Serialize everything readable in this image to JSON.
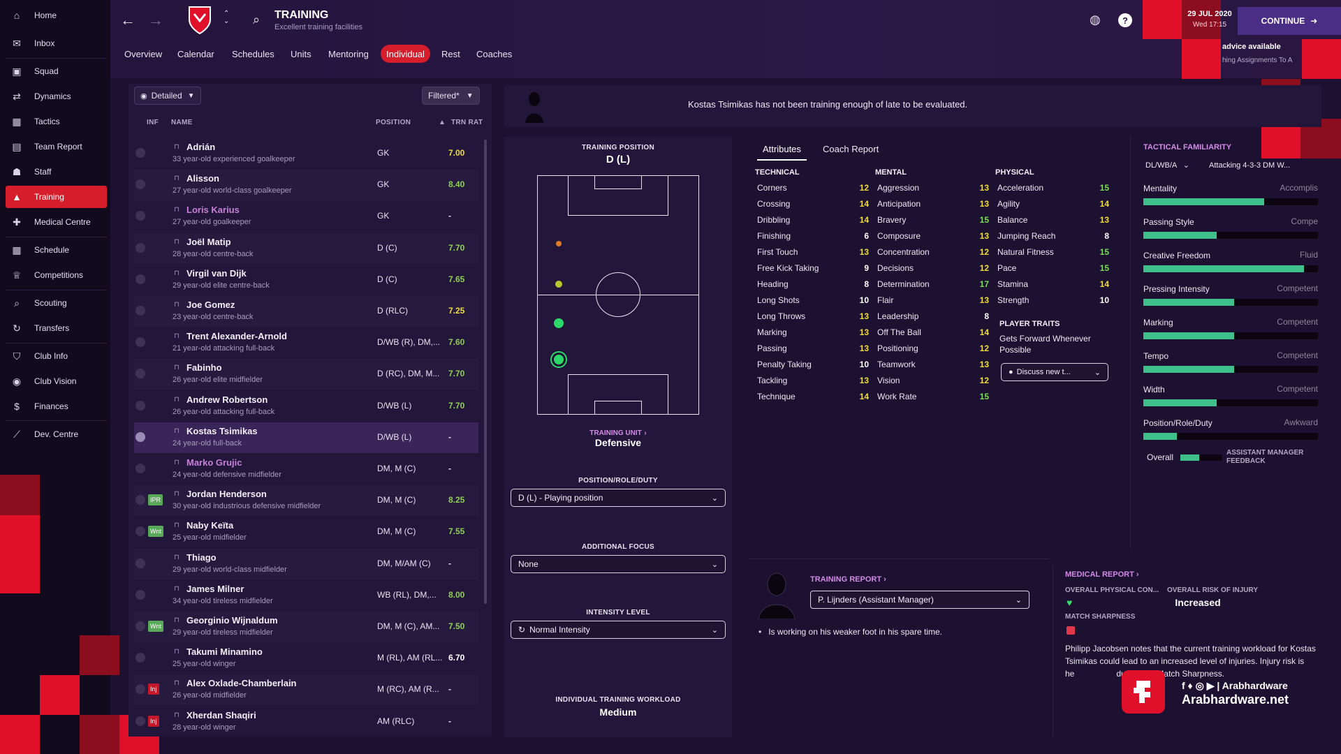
{
  "sidebar": {
    "items": [
      {
        "label": "Home",
        "icon": "home-icon"
      },
      {
        "label": "Inbox",
        "icon": "inbox-icon"
      },
      {
        "label": "Squad",
        "icon": "squad-icon"
      },
      {
        "label": "Dynamics",
        "icon": "dynamics-icon"
      },
      {
        "label": "Tactics",
        "icon": "tactics-icon"
      },
      {
        "label": "Team Report",
        "icon": "report-icon"
      },
      {
        "label": "Staff",
        "icon": "staff-icon"
      },
      {
        "label": "Training",
        "icon": "training-icon"
      },
      {
        "label": "Medical Centre",
        "icon": "medical-icon"
      },
      {
        "label": "Schedule",
        "icon": "schedule-icon"
      },
      {
        "label": "Competitions",
        "icon": "trophy-icon"
      },
      {
        "label": "Scouting",
        "icon": "scouting-icon"
      },
      {
        "label": "Transfers",
        "icon": "transfers-icon"
      },
      {
        "label": "Club Info",
        "icon": "club-info-icon"
      },
      {
        "label": "Club Vision",
        "icon": "club-vision-icon"
      },
      {
        "label": "Finances",
        "icon": "finances-icon"
      },
      {
        "label": "Dev. Centre",
        "icon": "dev-centre-icon"
      }
    ]
  },
  "header": {
    "title": "TRAINING",
    "subtitle": "Excellent training facilities",
    "date": "29 JUL 2020",
    "time": "Wed 17:15",
    "continue_label": "CONTINUE",
    "advice_title": "advice available",
    "advice_sub": "hing Assignments To A",
    "help_label": "?"
  },
  "tabs": [
    "Overview",
    "Calendar",
    "Schedules",
    "Units",
    "Mentoring",
    "Individual",
    "Rest",
    "Coaches"
  ],
  "list": {
    "view_label": "Detailed",
    "filter_label": "Filtered*",
    "col_inf": "INF",
    "col_name": "NAME",
    "col_position": "POSITION",
    "col_rating": "TRN RAT",
    "players": [
      {
        "name": "Adrián",
        "desc": "33 year-old experienced goalkeeper",
        "pos": "GK",
        "rating": "7.00",
        "inf": ""
      },
      {
        "name": "Alisson",
        "desc": "27 year-old world-class goalkeeper",
        "pos": "GK",
        "rating": "8.40",
        "inf": ""
      },
      {
        "name": "Loris Karius",
        "desc": "27 year-old goalkeeper",
        "pos": "GK",
        "rating": "-",
        "inf": ""
      },
      {
        "name": "Joël Matip",
        "desc": "28 year-old centre-back",
        "pos": "D (C)",
        "rating": "7.70",
        "inf": ""
      },
      {
        "name": "Virgil van Dijk",
        "desc": "29 year-old elite centre-back",
        "pos": "D (C)",
        "rating": "7.65",
        "inf": ""
      },
      {
        "name": "Joe Gomez",
        "desc": "23 year-old centre-back",
        "pos": "D (RLC)",
        "rating": "7.25",
        "inf": ""
      },
      {
        "name": "Trent Alexander-Arnold",
        "desc": "21 year-old attacking full-back",
        "pos": "D/WB (R), DM,...",
        "rating": "7.60",
        "inf": ""
      },
      {
        "name": "Fabinho",
        "desc": "26 year-old elite midfielder",
        "pos": "D (RC), DM, M...",
        "rating": "7.70",
        "inf": ""
      },
      {
        "name": "Andrew Robertson",
        "desc": "26 year-old attacking full-back",
        "pos": "D/WB (L)",
        "rating": "7.70",
        "inf": ""
      },
      {
        "name": "Kostas Tsimikas",
        "desc": "24 year-old full-back",
        "pos": "D/WB (L)",
        "rating": "-",
        "inf": ""
      },
      {
        "name": "Marko Grujic",
        "desc": "24 year-old defensive midfielder",
        "pos": "DM, M (C)",
        "rating": "-",
        "inf": ""
      },
      {
        "name": "Jordan Henderson",
        "desc": "30 year-old industrious defensive midfielder",
        "pos": "DM, M (C)",
        "rating": "8.25",
        "inf": "IPR"
      },
      {
        "name": "Naby Keïta",
        "desc": "25 year-old midfielder",
        "pos": "DM, M (C)",
        "rating": "7.55",
        "inf": "Wnt"
      },
      {
        "name": "Thiago",
        "desc": "29 year-old world-class midfielder",
        "pos": "DM, M/AM (C)",
        "rating": "-",
        "inf": ""
      },
      {
        "name": "James Milner",
        "desc": "34 year-old tireless midfielder",
        "pos": "WB (RL), DM,...",
        "rating": "8.00",
        "inf": ""
      },
      {
        "name": "Georginio Wijnaldum",
        "desc": "29 year-old tireless midfielder",
        "pos": "DM, M (C), AM...",
        "rating": "7.50",
        "inf": "Wnt"
      },
      {
        "name": "Takumi Minamino",
        "desc": "25 year-old winger",
        "pos": "M (RL), AM (RL...",
        "rating": "6.70",
        "inf": ""
      },
      {
        "name": "Alex Oxlade-Chamberlain",
        "desc": "26 year-old midfielder",
        "pos": "M (RC), AM (R...",
        "rating": "-",
        "inf": "Inj"
      },
      {
        "name": "Xherdan Shaqiri",
        "desc": "28 year-old winger",
        "pos": "AM (RLC)",
        "rating": "-",
        "inf": "Inj"
      }
    ]
  },
  "message": "Kostas Tsimikas has not been training enough of late to be evaluated.",
  "center": {
    "training_position_label": "TRAINING POSITION",
    "training_position": "D (L)",
    "training_unit_label": "TRAINING UNIT",
    "training_unit": "Defensive",
    "prd_label": "POSITION/ROLE/DUTY",
    "prd_value": "D (L) - Playing position",
    "focus_label": "ADDITIONAL FOCUS",
    "focus_value": "None",
    "intensity_label": "INTENSITY LEVEL",
    "intensity_value": "Normal Intensity",
    "workload_label": "INDIVIDUAL TRAINING WORKLOAD",
    "workload_value": "Medium"
  },
  "attributes": {
    "tabs": [
      "Attributes",
      "Coach Report"
    ],
    "technical_label": "TECHNICAL",
    "mental_label": "MENTAL",
    "physical_label": "PHYSICAL",
    "technical": [
      {
        "name": "Corners",
        "value": "12"
      },
      {
        "name": "Crossing",
        "value": "14"
      },
      {
        "name": "Dribbling",
        "value": "14"
      },
      {
        "name": "Finishing",
        "value": "6"
      },
      {
        "name": "First Touch",
        "value": "13"
      },
      {
        "name": "Free Kick Taking",
        "value": "9"
      },
      {
        "name": "Heading",
        "value": "8"
      },
      {
        "name": "Long Shots",
        "value": "10"
      },
      {
        "name": "Long Throws",
        "value": "13"
      },
      {
        "name": "Marking",
        "value": "13"
      },
      {
        "name": "Passing",
        "value": "13"
      },
      {
        "name": "Penalty Taking",
        "value": "10"
      },
      {
        "name": "Tackling",
        "value": "13"
      },
      {
        "name": "Technique",
        "value": "14"
      }
    ],
    "mental": [
      {
        "name": "Aggression",
        "value": "13"
      },
      {
        "name": "Anticipation",
        "value": "13"
      },
      {
        "name": "Bravery",
        "value": "15"
      },
      {
        "name": "Composure",
        "value": "13"
      },
      {
        "name": "Concentration",
        "value": "12"
      },
      {
        "name": "Decisions",
        "value": "12"
      },
      {
        "name": "Determination",
        "value": "17"
      },
      {
        "name": "Flair",
        "value": "13"
      },
      {
        "name": "Leadership",
        "value": "8"
      },
      {
        "name": "Off The Ball",
        "value": "14"
      },
      {
        "name": "Positioning",
        "value": "12"
      },
      {
        "name": "Teamwork",
        "value": "13"
      },
      {
        "name": "Vision",
        "value": "12"
      },
      {
        "name": "Work Rate",
        "value": "15"
      }
    ],
    "physical": [
      {
        "name": "Acceleration",
        "value": "15"
      },
      {
        "name": "Agility",
        "value": "14"
      },
      {
        "name": "Balance",
        "value": "13"
      },
      {
        "name": "Jumping Reach",
        "value": "8"
      },
      {
        "name": "Natural Fitness",
        "value": "15"
      },
      {
        "name": "Pace",
        "value": "15"
      },
      {
        "name": "Stamina",
        "value": "14"
      },
      {
        "name": "Strength",
        "value": "10"
      }
    ],
    "traits_label": "PLAYER TRAITS",
    "traits": "Gets Forward Whenever Possible",
    "discuss_label": "Discuss new t..."
  },
  "tactical": {
    "title": "TACTICAL FAMILIARITY",
    "role_select": "DL/WB/A",
    "tactic_select": "Attacking 4-3-3 DM W...",
    "rows": [
      {
        "label": "Mentality",
        "status": "Accomplis",
        "level": 0.69
      },
      {
        "label": "Passing Style",
        "status": "Compe",
        "level": 0.42
      },
      {
        "label": "Creative Freedom",
        "status": "Fluid",
        "level": 0.92
      },
      {
        "label": "Pressing Intensity",
        "status": "Competent",
        "level": 0.52
      },
      {
        "label": "Marking",
        "status": "Competent",
        "level": 0.52
      },
      {
        "label": "Tempo",
        "status": "Competent",
        "level": 0.52
      },
      {
        "label": "Width",
        "status": "Competent",
        "level": 0.42
      },
      {
        "label": "Position/Role/Duty",
        "status": "Awkward",
        "level": 0.19
      }
    ],
    "overall_label": "Overall",
    "feedback_label": "ASSISTANT MANAGER FEEDBACK"
  },
  "training_report": {
    "title": "TRAINING REPORT",
    "coach": "P. Lijnders (Assistant Manager)",
    "note": "Is working on his weaker foot in his spare time."
  },
  "medical": {
    "title": "MEDICAL REPORT",
    "physical_label": "OVERALL PHYSICAL CON...",
    "injury_label": "OVERALL RISK OF INJURY",
    "injury_value": "Increased",
    "sharpness_label": "MATCH SHARPNESS",
    "note": "Philipp Jacobsen notes that the current training workload for Kostas Tsimikas could lead to an increased level of injuries. Injury risk is he",
    "note_tail": "due to low Match Sharpness."
  },
  "watermark": {
    "brand": "Arabhardware",
    "url": "Arabhardware.net"
  },
  "colors": {
    "accent": "#d51d2b",
    "rating_green": "#8fd14f",
    "rating_yellow": "#f0dc3c",
    "value_green": "#7ddc5a",
    "bar_fill": "#3fbf8a"
  }
}
